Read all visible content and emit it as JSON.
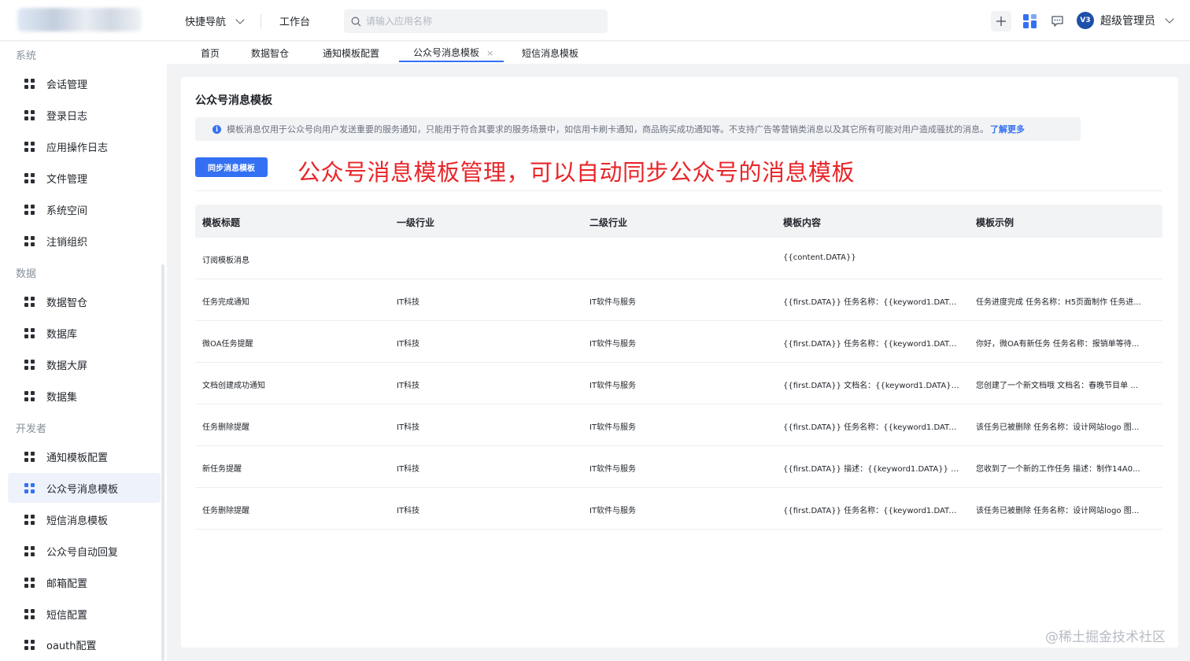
{
  "header": {
    "quick_nav": "快捷导航",
    "workbench": "工作台",
    "search_placeholder": "请输入应用名称",
    "user_name": "超级管理员",
    "avatar_text": "V3"
  },
  "sidebar": {
    "groups": [
      {
        "title": "系统",
        "items": [
          "会话管理",
          "登录日志",
          "应用操作日志",
          "文件管理",
          "系统空间",
          "注销组织"
        ]
      },
      {
        "title": "数据",
        "items": [
          "数据智仓",
          "数据库",
          "数据大屏",
          "数据集"
        ]
      },
      {
        "title": "开发者",
        "items": [
          "通知模板配置",
          "公众号消息模板",
          "短信消息模板",
          "公众号自动回复",
          "邮箱配置",
          "短信配置",
          "oauth配置"
        ]
      }
    ],
    "active_item": "公众号消息模板"
  },
  "tabs": [
    {
      "label": "首页"
    },
    {
      "label": "数据智仓"
    },
    {
      "label": "通知模板配置"
    },
    {
      "label": "公众号消息模板",
      "active": true,
      "close": "×"
    },
    {
      "label": "短信消息模板"
    }
  ],
  "page": {
    "title": "公众号消息模板",
    "notice_text": "模板消息仅用于公众号向用户发送重要的服务通知，只能用于符合其要求的服务场景中，如信用卡刷卡通知，商品购买成功通知等。不支持广告等营销类消息以及其它所有可能对用户造成骚扰的消息。",
    "learn_more": "了解更多",
    "sync_button": "同步消息模板",
    "annotation": "公众号消息模板管理，可以自动同步公众号的消息模板"
  },
  "table": {
    "columns": [
      "模板标题",
      "一级行业",
      "二级行业",
      "模板内容",
      "模板示例"
    ],
    "rows": [
      [
        "订阅模板消息",
        "",
        "",
        "{{content.DATA}}",
        ""
      ],
      [
        "任务完成通知",
        "IT科技",
        "IT软件与服务",
        "{{first.DATA}} 任务名称：{{keyword1.DATA...",
        "任务进度完成 任务名称：H5页面制作 任务进..."
      ],
      [
        "微OA任务提醒",
        "IT科技",
        "IT软件与服务",
        "{{first.DATA}} 任务名称：{{keyword1.DATA...",
        "你好，微OA有新任务 任务名称：报销单等待..."
      ],
      [
        "文档创建成功通知",
        "IT科技",
        "IT软件与服务",
        "{{first.DATA}} 文档名：{{keyword1.DATA}} ...",
        "您创建了一个新文档哦 文档名：春晚节目单 ..."
      ],
      [
        "任务删除提醒",
        "IT科技",
        "IT软件与服务",
        "{{first.DATA}} 任务名称：{{keyword1.DATA...",
        "该任务已被删除 任务名称：设计网站logo 图..."
      ],
      [
        "新任务提醒",
        "IT科技",
        "IT软件与服务",
        "{{first.DATA}} 描述：{{keyword1.DATA}} 工...",
        "您收到了一个新的工作任务 描述：制作14A0..."
      ],
      [
        "任务删除提醒",
        "IT科技",
        "IT软件与服务",
        "{{first.DATA}} 任务名称：{{keyword1.DATA...",
        "该任务已被删除 任务名称：设计网站logo 图..."
      ]
    ]
  },
  "watermark": "@稀土掘金技术社区",
  "colors": {
    "primary": "#3470f3",
    "annotation": "#e8262a"
  }
}
